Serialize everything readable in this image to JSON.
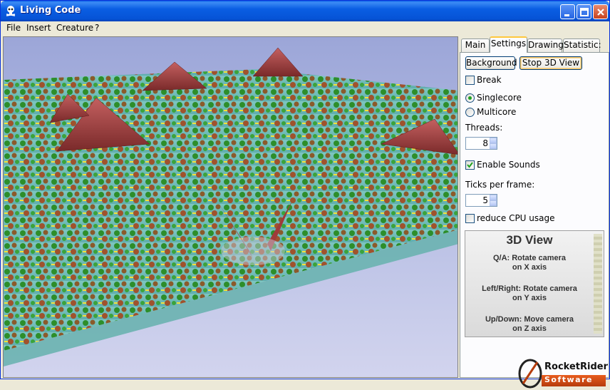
{
  "window": {
    "title": "Living Code"
  },
  "menu": [
    "File",
    "Insert",
    "Creature",
    "?"
  ],
  "tabs": [
    "Main",
    "Settings",
    "Drawing",
    "Statistic:"
  ],
  "settings": {
    "background_label": "Background",
    "stop3d_label": "Stop 3D View",
    "break_label": "Break",
    "break_checked": false,
    "singlecore_label": "Singlecore",
    "multicore_label": "Multicore",
    "core_mode": "Singlecore",
    "threads_label": "Threads:",
    "threads_value": "8",
    "sounds_label": "Enable Sounds",
    "sounds_checked": true,
    "ticks_label": "Ticks per frame:",
    "ticks_value": "5",
    "reduce_label": "reduce CPU usage",
    "reduce_checked": false
  },
  "help": {
    "title": "3D View",
    "lines": [
      "Q/A: Rotate camera",
      "on X axis",
      "Left/Right: Rotate camera",
      "on Y axis",
      "Up/Down: Move camera",
      "on Z axis"
    ]
  },
  "logo": {
    "name": "RocketRider",
    "sub": "Software"
  },
  "colors": {
    "accent": "#0A5EE3",
    "tab_highlight": "#FFC83C",
    "radio_dot": "#21A121"
  }
}
